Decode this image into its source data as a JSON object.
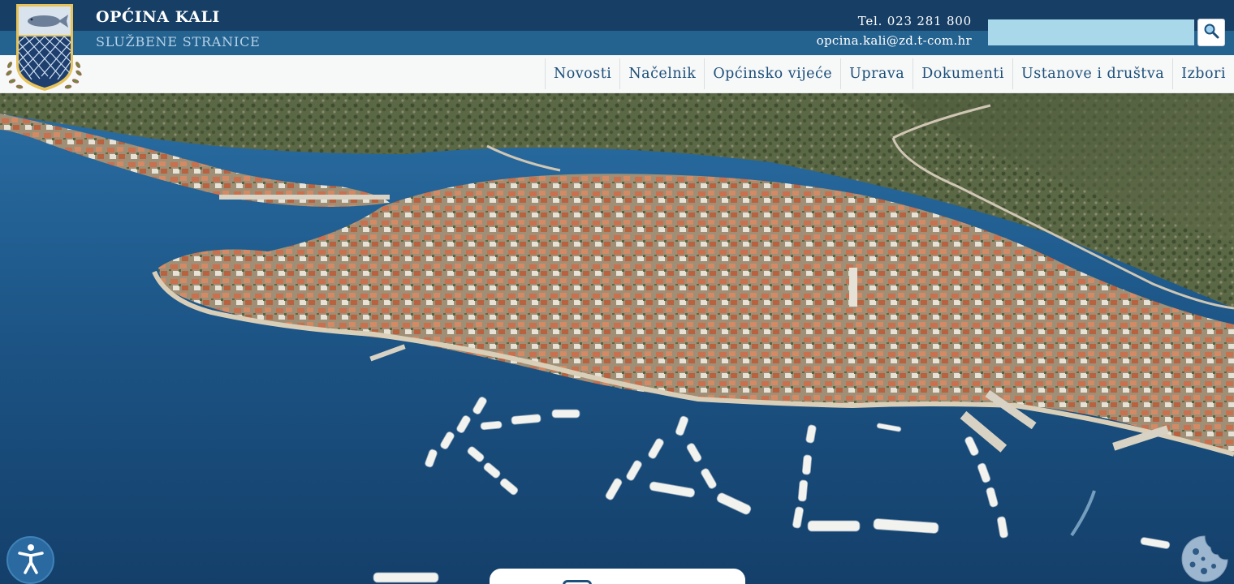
{
  "site": {
    "title": "OPĆINA KALI",
    "subtitle": "SLUŽBENE STRANICE"
  },
  "contact": {
    "phone": "Tel. 023 281 800",
    "email": "opcina.kali@zd.t-com.hr"
  },
  "search": {
    "placeholder": "",
    "value": "",
    "button_icon": "search-icon"
  },
  "nav": {
    "items": [
      {
        "label": "Novosti"
      },
      {
        "label": "Načelnik"
      },
      {
        "label": "Općinsko vijeće"
      },
      {
        "label": "Uprava"
      },
      {
        "label": "Dokumenti"
      },
      {
        "label": "Ustanove i društva"
      },
      {
        "label": "Izbori"
      }
    ]
  },
  "hero": {
    "image": "aerial-photo-of-kali"
  },
  "widgets": {
    "accessibility_icon": "accessibility-person-icon",
    "cookie_icon": "cookie-icon",
    "card_icon": "document-icon"
  },
  "colors": {
    "header_dark": "#173f66",
    "header_mid": "#24628f",
    "nav_text": "#1c4f7a",
    "search_field": "#a8d8ea",
    "sea": "#1d5585"
  }
}
